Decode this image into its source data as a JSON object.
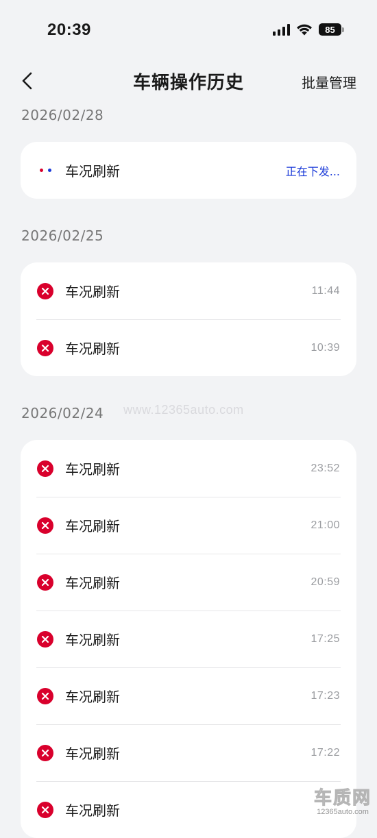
{
  "status_bar": {
    "time": "20:39",
    "battery": "85"
  },
  "header": {
    "title": "车辆操作历史",
    "back_icon": "chevron-left-icon",
    "batch_manage_label": "批量管理"
  },
  "colors": {
    "error_red": "#d9002c",
    "dot_red": "#d9002c",
    "dot_blue": "#1838d8",
    "pending_text": "#1838d8"
  },
  "sections": [
    {
      "date": "2026/02/28",
      "items": [
        {
          "label": "车况刷新",
          "status": "正在下发...",
          "icon": "pending-dots-icon"
        }
      ]
    },
    {
      "date": "2026/02/25",
      "items": [
        {
          "label": "车况刷新",
          "time": "11:44",
          "icon": "failed-icon"
        },
        {
          "label": "车况刷新",
          "time": "10:39",
          "icon": "failed-icon"
        }
      ]
    },
    {
      "date": "2026/02/24",
      "items": [
        {
          "label": "车况刷新",
          "time": "23:52",
          "icon": "failed-icon"
        },
        {
          "label": "车况刷新",
          "time": "21:00",
          "icon": "failed-icon"
        },
        {
          "label": "车况刷新",
          "time": "20:59",
          "icon": "failed-icon"
        },
        {
          "label": "车况刷新",
          "time": "17:25",
          "icon": "failed-icon"
        },
        {
          "label": "车况刷新",
          "time": "17:23",
          "icon": "failed-icon"
        },
        {
          "label": "车况刷新",
          "time": "17:22",
          "icon": "failed-icon"
        },
        {
          "label": "车况刷新",
          "time": "",
          "icon": "failed-icon"
        }
      ]
    }
  ],
  "watermark": {
    "url_text": "www.12365auto.com",
    "logo_text": "车质网",
    "logo_sub": "12365auto.com"
  }
}
